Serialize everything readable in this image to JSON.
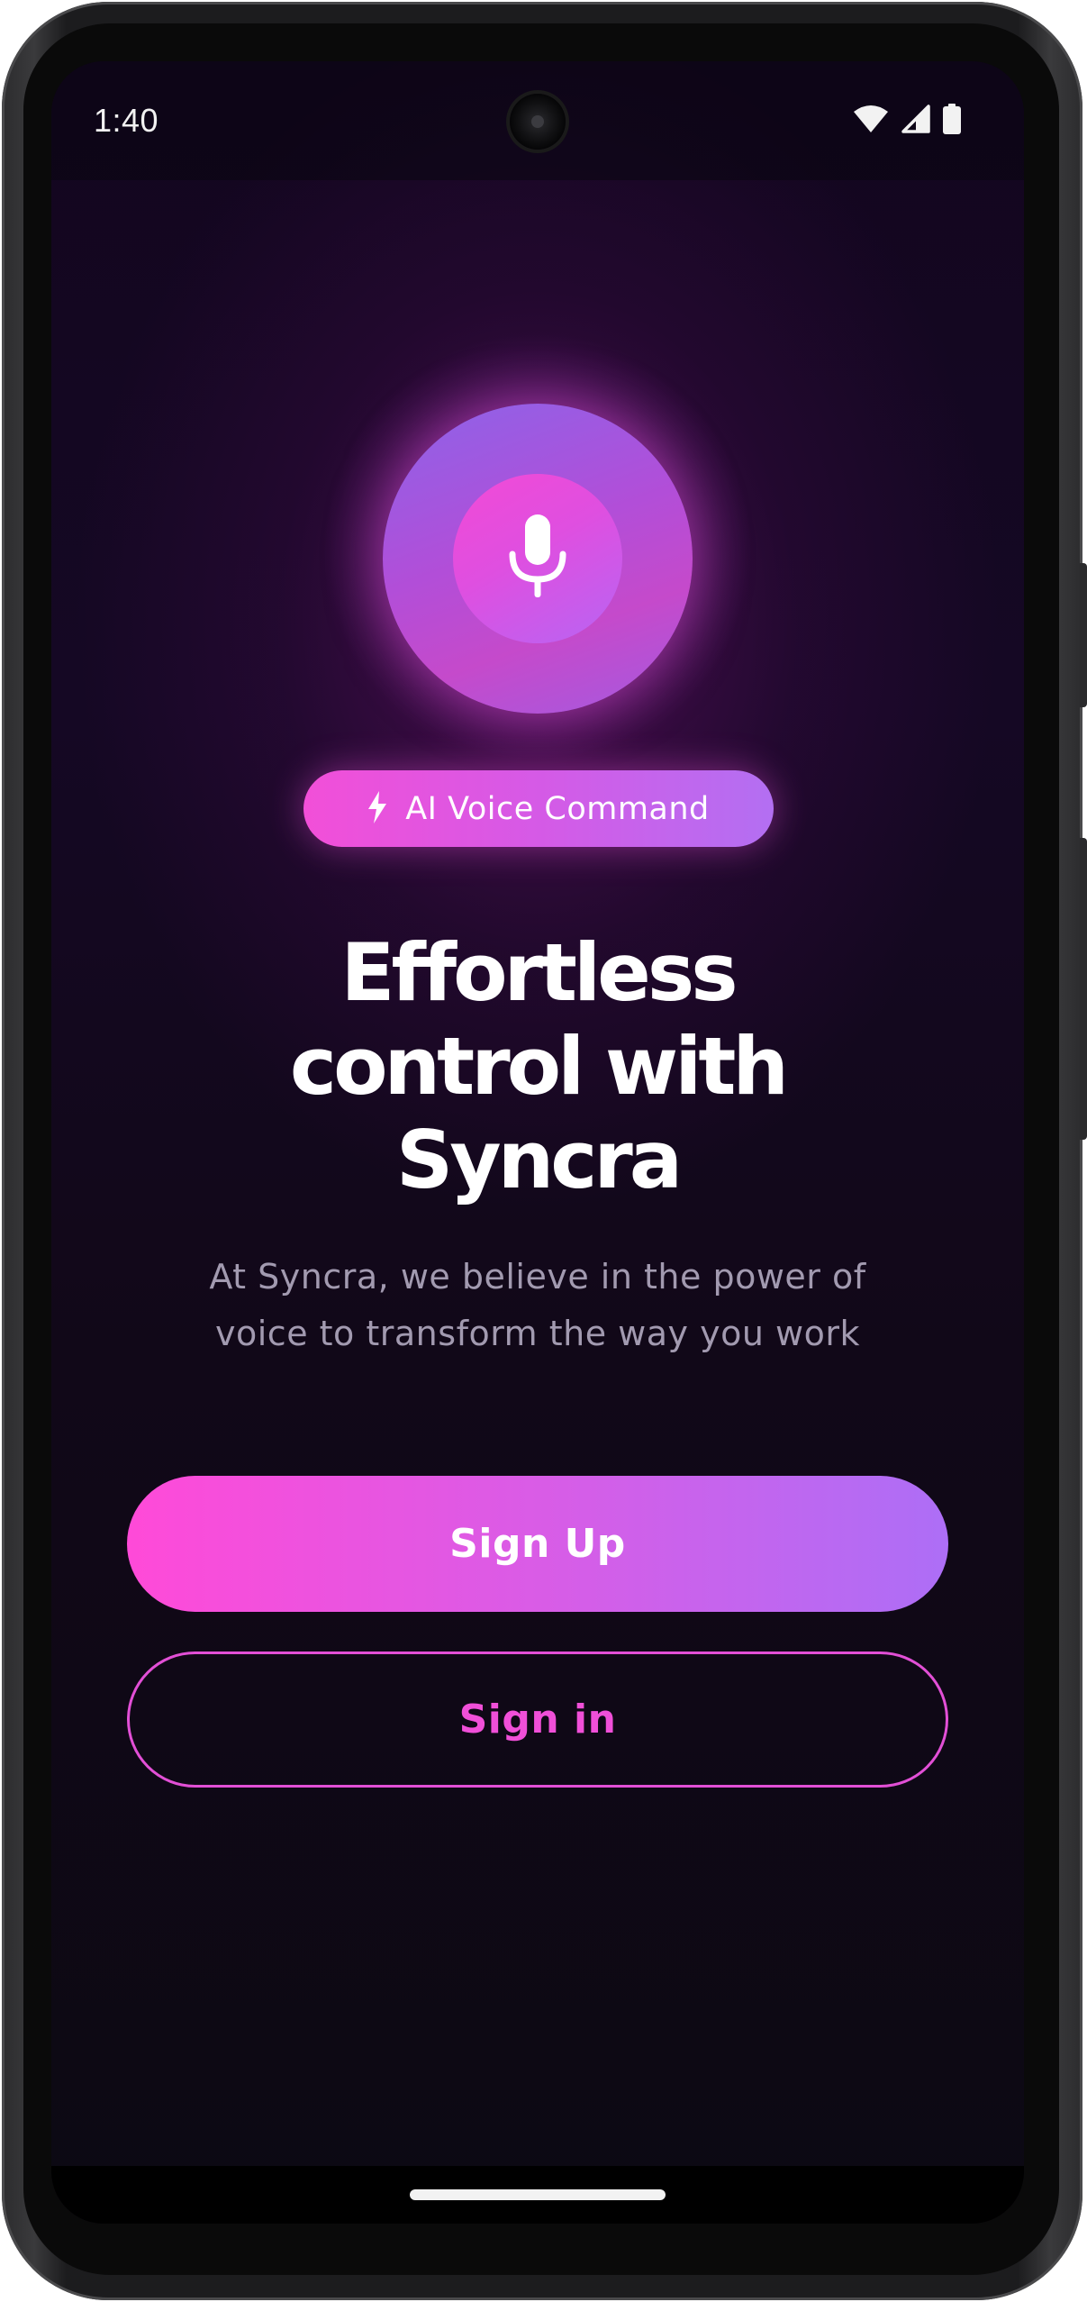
{
  "status_bar": {
    "time": "1:40",
    "icons": [
      "wifi-icon",
      "cellular-signal-icon",
      "battery-icon"
    ]
  },
  "hero": {
    "icon": "microphone-icon",
    "badge": {
      "icon": "lightning-bolt-icon",
      "label": "AI Voice Command"
    },
    "headline": {
      "line1": "Effortless",
      "line2": "control with",
      "line3": "Syncra"
    },
    "subtitle": {
      "line1": "At Syncra, we believe in the power of",
      "line2": "voice to transform the way you work"
    }
  },
  "actions": {
    "sign_up_label": "Sign Up",
    "sign_in_label": "Sign in"
  },
  "colors": {
    "background": "#13061f",
    "accent_pink": "#ff4ad8",
    "accent_purple": "#ad6ef6",
    "subtitle_text": "#a29ab0"
  }
}
